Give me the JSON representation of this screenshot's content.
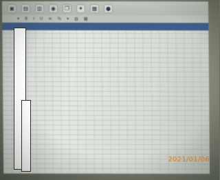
{
  "toolbar": {
    "buttons": [
      {
        "icon": "open-icon",
        "glyph": "▣"
      },
      {
        "icon": "save-icon",
        "glyph": "▤"
      },
      {
        "icon": "print-icon",
        "glyph": "▥"
      },
      {
        "icon": "web-icon",
        "glyph": "◉"
      },
      {
        "icon": "copy-icon",
        "glyph": "❐"
      },
      {
        "icon": "settings-icon",
        "glyph": "✦"
      },
      {
        "icon": "chart-icon",
        "glyph": "▦"
      },
      {
        "icon": "help-icon",
        "glyph": "●"
      }
    ]
  },
  "format_bar": {
    "items": [
      "▾",
      "B",
      "I",
      "U",
      "≡",
      "%",
      "▾",
      "▤",
      "▦"
    ]
  },
  "sheet_header": {
    "cells": [
      "",
      "",
      "",
      "",
      "",
      "",
      "",
      "",
      "",
      ""
    ]
  },
  "rows": [
    {
      "date": "",
      "a": "",
      "b": "",
      "nums": "",
      "nums2": "",
      "tail": ""
    }
  ],
  "timestamp": "2021/01/06",
  "colors": {
    "timestamp": "#e58a2f",
    "header_bg": "#3f5d8c",
    "redaction": "#ffffff"
  }
}
